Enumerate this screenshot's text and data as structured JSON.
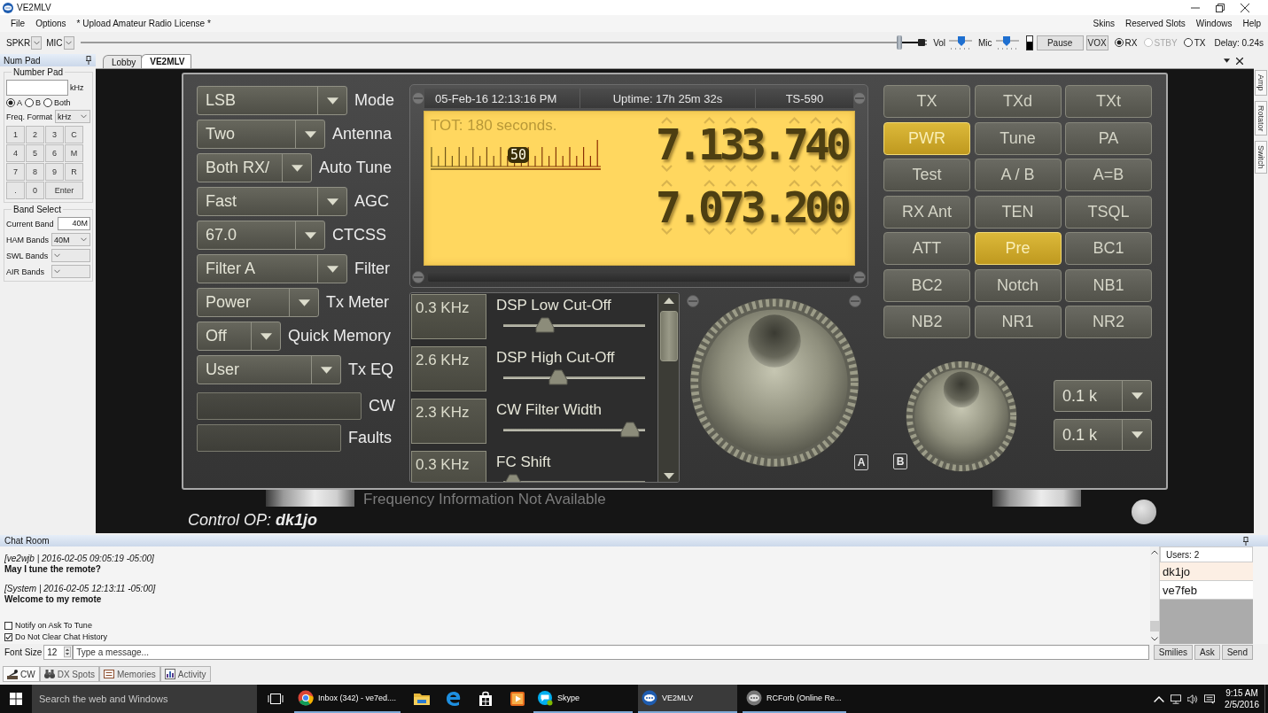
{
  "window": {
    "title": "VE2MLV"
  },
  "menu": {
    "left": [
      {
        "label": "File"
      },
      {
        "label": "Options"
      },
      {
        "label": "* Upload Amateur Radio License *"
      }
    ],
    "right": [
      {
        "label": "Skins"
      },
      {
        "label": "Reserved Slots"
      },
      {
        "label": "Windows"
      },
      {
        "label": "Help"
      }
    ]
  },
  "toolbar": {
    "speaker": "SPKR",
    "mic": "MIC",
    "long_slider": {
      "level": 1
    },
    "volume": {
      "label": "Vol",
      "level": 0.55
    },
    "mic_gain": {
      "label": "Mic",
      "level": 0.45
    },
    "audio_meter": {
      "level": 0.6
    },
    "buttons": [
      "Pause",
      "VOX"
    ],
    "modes": [
      {
        "label": "RX",
        "selected": true,
        "disabled": false
      },
      {
        "label": "STBY",
        "selected": false,
        "disabled": true
      },
      {
        "label": "TX",
        "selected": false,
        "disabled": false
      }
    ],
    "delay": "Delay: 0.24s"
  },
  "num_pad": {
    "title": "Num Pad",
    "group": "Number Pad",
    "unit": "kHz",
    "vfo": [
      {
        "label": "A",
        "selected": true
      },
      {
        "label": "B",
        "selected": false
      },
      {
        "label": "Both",
        "selected": false
      }
    ],
    "format_label": "Freq. Format",
    "format": "kHz",
    "keys": [
      {
        "label": "1",
        "kind": "key"
      },
      {
        "label": "2",
        "kind": "key"
      },
      {
        "label": "3",
        "kind": "key"
      },
      {
        "label": "C",
        "kind": "key"
      },
      {
        "label": "4",
        "kind": "key"
      },
      {
        "label": "5",
        "kind": "key"
      },
      {
        "label": "6",
        "kind": "key"
      },
      {
        "label": "M",
        "kind": "key"
      },
      {
        "label": "7",
        "kind": "key"
      },
      {
        "label": "8",
        "kind": "key"
      },
      {
        "label": "9",
        "kind": "key"
      },
      {
        "label": "R",
        "kind": "key"
      },
      {
        "label": ".",
        "kind": "key"
      },
      {
        "label": "0",
        "kind": "key"
      },
      {
        "label": "Enter",
        "kind": "wide"
      }
    ],
    "band_group": "Band Select",
    "bands": [
      {
        "label": "Current Band",
        "value": "40M",
        "kind": "text"
      },
      {
        "label": "HAM Bands",
        "value": "40M",
        "kind": "select"
      },
      {
        "label": "SWL Bands",
        "kind": "select"
      },
      {
        "label": "AIR Bands",
        "kind": "select"
      }
    ]
  },
  "tabs": [
    {
      "label": "Lobby",
      "selected": false
    },
    {
      "label": "VE2MLV",
      "selected": true
    }
  ],
  "side_tabs": [
    {
      "label": "Amp"
    },
    {
      "label": "Rotator"
    },
    {
      "label": "Switch"
    }
  ],
  "radio": {
    "controls": [
      {
        "kind": "select",
        "value": "LSB",
        "label": "Mode"
      },
      {
        "kind": "select",
        "value": "Two",
        "label": "Antenna"
      },
      {
        "kind": "select",
        "value": "Both RX/",
        "label": "Auto Tune"
      },
      {
        "kind": "select",
        "value": "Fast",
        "label": "AGC"
      },
      {
        "kind": "select",
        "value": "67.0",
        "label": "CTCSS"
      },
      {
        "kind": "select",
        "value": "Filter A",
        "label": "Filter"
      },
      {
        "kind": "select",
        "value": "Power",
        "label": "Tx Meter"
      },
      {
        "kind": "select",
        "value": "Off",
        "label": "Quick Memory"
      },
      {
        "kind": "select",
        "value": "User",
        "label": "Tx EQ"
      },
      {
        "kind": "blank",
        "label": "CW"
      },
      {
        "kind": "blank",
        "label": "Faults"
      }
    ],
    "display": {
      "date": "05-Feb-16 12:13:16 PM",
      "uptime": "Uptime: 17h 25m 32s",
      "model": "TS-590",
      "tot": "TOT: 180 seconds.",
      "s_meter": "50",
      "frequencies": [
        "7.133.740",
        "7.073.200"
      ]
    },
    "dsp": [
      {
        "value": "0.3 KHz",
        "label": "DSP Low Cut-Off",
        "level": 0.26
      },
      {
        "value": "2.6 KHz",
        "label": "DSP High Cut-Off",
        "level": 0.37
      },
      {
        "value": "2.3 KHz",
        "label": "CW Filter Width",
        "level": 0.96
      },
      {
        "value": "0.3 KHz",
        "label": "FC Shift",
        "level": 0
      }
    ],
    "vfo_buttons": [
      "A",
      "B"
    ],
    "buttons": [
      {
        "label": "TX",
        "on": false
      },
      {
        "label": "TXd",
        "on": false
      },
      {
        "label": "TXt",
        "on": false
      },
      {
        "label": "PWR",
        "on": true
      },
      {
        "label": "Tune",
        "on": false
      },
      {
        "label": "PA",
        "on": false
      },
      {
        "label": "Test",
        "on": false
      },
      {
        "label": "A / B",
        "on": false
      },
      {
        "label": "A=B",
        "on": false
      },
      {
        "label": "RX Ant",
        "on": false
      },
      {
        "label": "TEN",
        "on": false
      },
      {
        "label": "TSQL",
        "on": false
      },
      {
        "label": "ATT",
        "on": false
      },
      {
        "label": "Pre",
        "on": true
      },
      {
        "label": "BC1",
        "on": false
      },
      {
        "label": "BC2",
        "on": false
      },
      {
        "label": "Notch",
        "on": false
      },
      {
        "label": "NB1",
        "on": false
      },
      {
        "label": "NB2",
        "on": false
      },
      {
        "label": "NR1",
        "on": false
      },
      {
        "label": "NR2",
        "on": false
      }
    ],
    "steps": [
      "0.1 k",
      "0.1 k"
    ],
    "status": "Frequency Information Not Available",
    "operator": "Control OP: **dk1jo**"
  },
  "chat": {
    "title": "Chat Room",
    "messages": [
      {
        "header": "[ve2wjb | 2016-02-05 09:05:19 -05:00]",
        "text": "May I tune the remote?"
      },
      {
        "header": "[System | 2016-02-05 12:13:11 -05:00]",
        "text": "Welcome to my remote"
      }
    ],
    "options": [
      {
        "label": "Notify on Ask To Tune",
        "checked": false
      },
      {
        "label": "Do Not Clear Chat History",
        "checked": true
      }
    ],
    "font_size_label": "Font Size",
    "font_size": "12",
    "message": {
      "placeholder": "Type a message..."
    },
    "buttons": [
      "Smilies",
      "Ask",
      "Send"
    ],
    "users_header": "Users: 2",
    "users": [
      {
        "name": "dk1jo",
        "selected": true
      },
      {
        "name": "ve7feb",
        "selected": false
      }
    ]
  },
  "bottom_tabs": [
    {
      "label": "CW",
      "selected": true
    },
    {
      "label": "DX Spots",
      "selected": false
    },
    {
      "label": "Memories",
      "selected": false
    },
    {
      "label": "Activity",
      "selected": false
    }
  ],
  "taskbar": {
    "search": {
      "placeholder": "Search the web and Windows"
    },
    "apps": [
      {
        "label": "Inbox (342) - ve7ed....",
        "active": false
      },
      {
        "label": "Skype",
        "active": false
      },
      {
        "label": "VE2MLV",
        "active": true
      },
      {
        "label": "RCForb (Online Re...",
        "active": false
      }
    ],
    "time": "9:15 AM",
    "date": "2/5/2016"
  }
}
